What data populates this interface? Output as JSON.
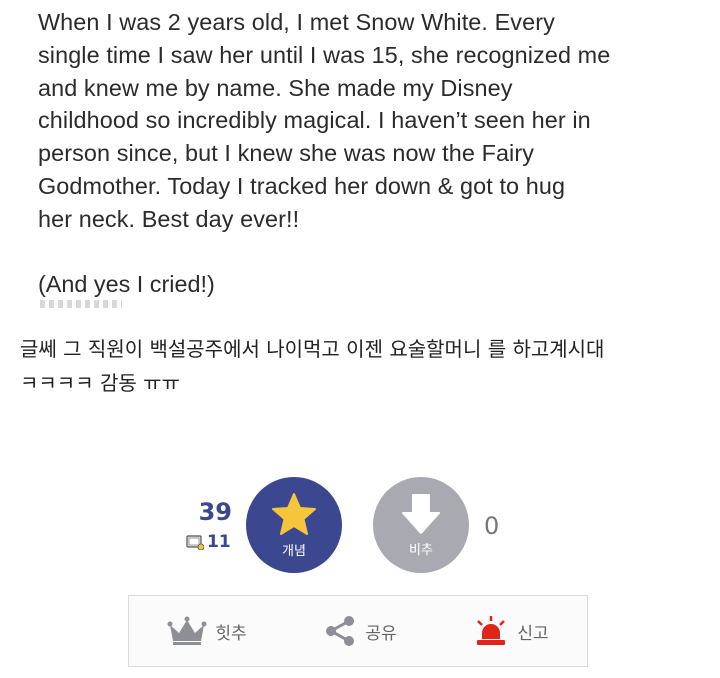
{
  "screenshot": {
    "paragraph": "When I was 2 years old, I met Snow White. Every\nsingle time I saw her until I was 15, she recognized me\nand knew me by name. She made my Disney\nchildhood so incredibly magical. I haven’t seen her in\nperson since, but I knew she was now the Fairy\nGodmother. Today I tracked her down & got to hug\nher neck. Best day ever!!",
    "aside": "(And yes I cried!)"
  },
  "comment": {
    "line1": "글쎄 그 직원이 백설공주에서 나이먹고 이젠 요술할머니 를 하고계시대",
    "line2": "ㅋㅋㅋㅋ 감동 ㅠㅠ"
  },
  "vote": {
    "up_count": "39",
    "sub_count": "11",
    "up_label": "개념",
    "down_label": "비추",
    "down_count": "0",
    "up_color": "#3b4890",
    "down_color": "#a9a9b2",
    "star_color": "#f6c53b"
  },
  "actions": [
    {
      "label": "힛추",
      "icon": "crown-icon"
    },
    {
      "label": "공유",
      "icon": "share-icon"
    },
    {
      "label": "신고",
      "icon": "siren-icon"
    }
  ]
}
